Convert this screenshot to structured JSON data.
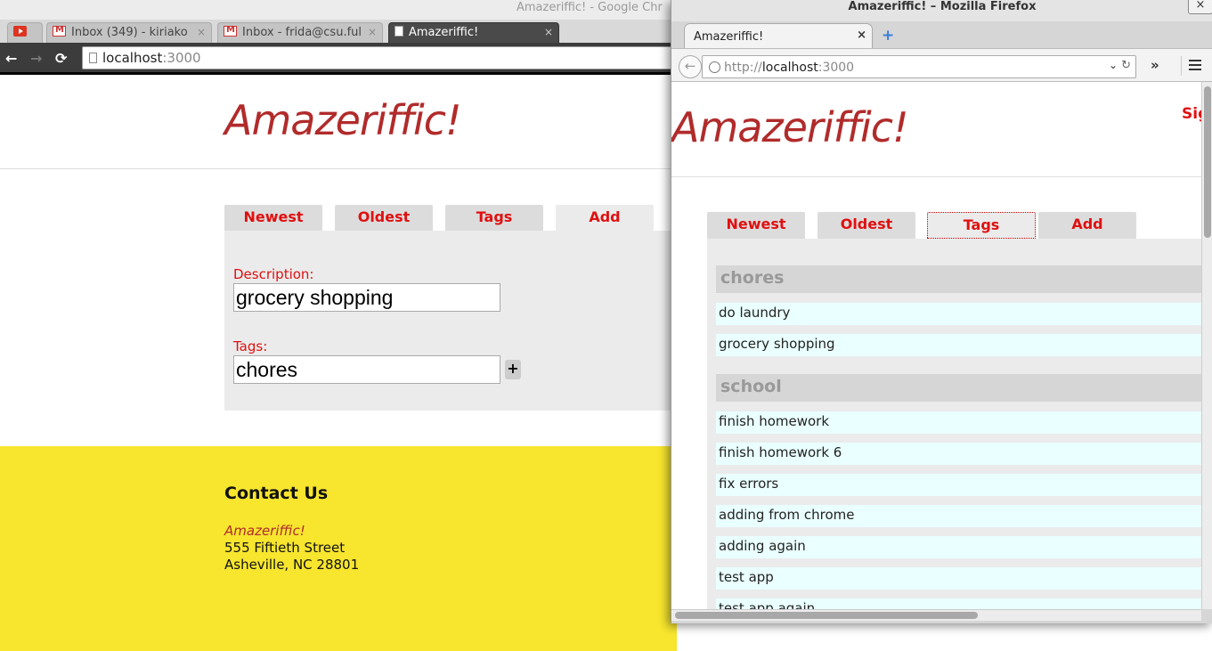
{
  "chrome": {
    "window_title": "Amazeriffic! - Google Chr",
    "tabs": [
      {
        "label": "",
        "icon": "youtube-icon"
      },
      {
        "label": "Inbox (349) - kiriako",
        "icon": "gmail-icon"
      },
      {
        "label": "Inbox - frida@csu.ful",
        "icon": "gmail-icon"
      },
      {
        "label": "Amazeriffic!",
        "icon": "page-icon",
        "active": true
      }
    ],
    "tab_close": "×",
    "url_host": "localhost",
    "url_port": ":3000",
    "nav": {
      "back": "←",
      "forward": "→",
      "reload": "⟳"
    },
    "page": {
      "brand": "Amazeriffic!",
      "tabs": [
        "Newest",
        "Oldest",
        "Tags",
        "Add"
      ],
      "active_tab": "Add",
      "description_label": "Description:",
      "description_value": "grocery shopping",
      "tags_label": "Tags:",
      "tags_value": "chores",
      "plus_label": "+",
      "footer": {
        "heading": "Contact Us",
        "brand": "Amazeriffic!",
        "street": "555 Fiftieth Street",
        "city": "Asheville, NC 28801"
      }
    }
  },
  "firefox": {
    "window_title": "Amazeriffic! – Mozilla Firefox",
    "close_window": "×",
    "tab_label": "Amazeriffic!",
    "tab_close": "×",
    "new_tab": "+",
    "url_scheme": "http://",
    "url_host": "localhost",
    "url_port": ":3000",
    "overflow": "»",
    "page": {
      "brand": "Amazeriffic!",
      "signin": "Sig",
      "tabs": [
        "Newest",
        "Oldest",
        "Tags",
        "Add"
      ],
      "active_tab": "Tags",
      "groups": [
        {
          "name": "chores",
          "items": [
            "do laundry",
            "grocery shopping"
          ]
        },
        {
          "name": "school",
          "items": [
            "finish homework",
            "finish homework 6",
            "fix errors",
            "adding from chrome",
            "adding again",
            "test app",
            "test app again"
          ]
        }
      ]
    }
  },
  "colors": {
    "brand": "#b12b2b",
    "tab_text": "#e01010",
    "footer_bg": "#f7e52e",
    "todo_bg": "#eaffff"
  }
}
